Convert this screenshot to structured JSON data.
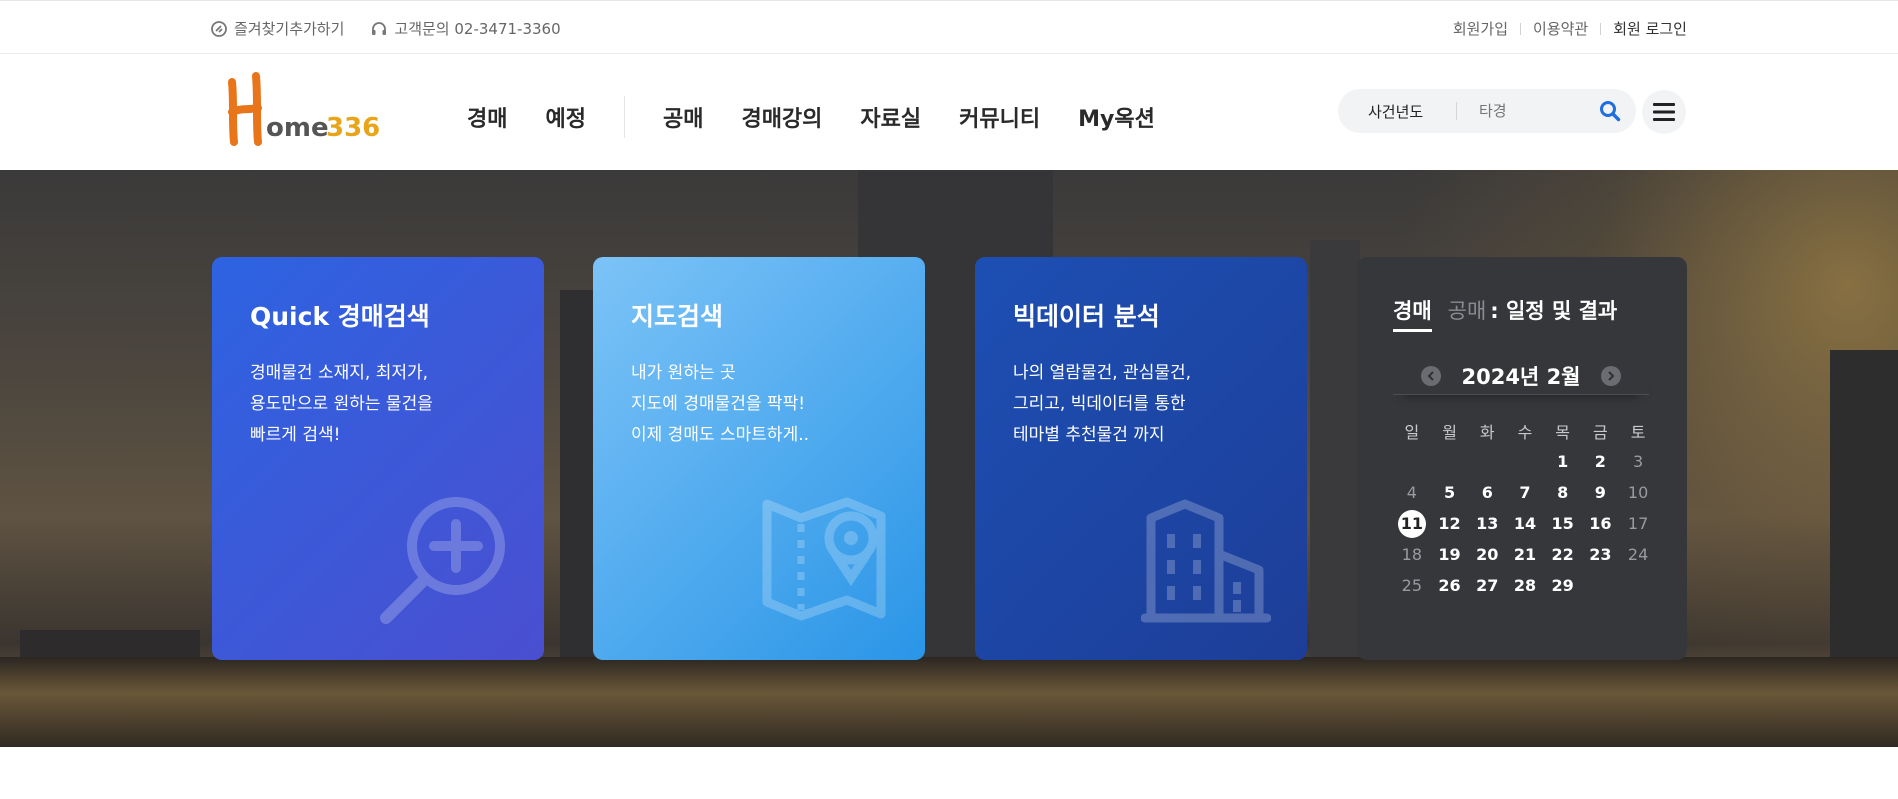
{
  "topbar": {
    "bookmark_label": "즐겨찾기추가하기",
    "contact_label": "고객문의 02-3471-3360",
    "links": [
      "회원가입",
      "이용약관",
      "회원 로그인"
    ]
  },
  "header": {
    "logo_text_h": "H",
    "logo_text_ome": "ome",
    "logo_text_num": "336",
    "nav_group1": [
      "경매",
      "예정"
    ],
    "nav_group2": [
      "공매",
      "경매강의",
      "자료실",
      "커뮤니티",
      "My옥션"
    ],
    "search": {
      "select_value": "사건년도",
      "placeholder": "타경"
    }
  },
  "cards": [
    {
      "title": "Quick 경매검색",
      "lines": [
        "경매물건 소재지, 최저가,",
        "용도만으로 원하는 물건을",
        "빠르게 검색!"
      ],
      "icon": "magnifier-plus-icon"
    },
    {
      "title": "지도검색",
      "lines": [
        "내가 원하는 곳",
        "지도에 경매물건을 팍팍!",
        "이제 경매도 스마트하게.."
      ],
      "icon": "map-pin-icon"
    },
    {
      "title": "빅데이터 분석",
      "lines": [
        "나의 열람물건, 관심물건,",
        "그리고, 빅데이터를 통한",
        "테마별 추천물건 까지"
      ],
      "icon": "building-icon"
    }
  ],
  "calendar": {
    "tab_active": "경매",
    "tab_inactive": "공매",
    "tab_suffix": ": 일정 및 결과",
    "month_title": "2024년 2월",
    "weekdays": [
      "일",
      "월",
      "화",
      "수",
      "목",
      "금",
      "토"
    ],
    "weeks": [
      [
        "",
        "",
        "",
        "",
        "1",
        "2",
        "3"
      ],
      [
        "4",
        "5",
        "6",
        "7",
        "8",
        "9",
        "10"
      ],
      [
        "11",
        "12",
        "13",
        "14",
        "15",
        "16",
        "17"
      ],
      [
        "18",
        "19",
        "20",
        "21",
        "22",
        "23",
        "24"
      ],
      [
        "25",
        "26",
        "27",
        "28",
        "29",
        "",
        ""
      ]
    ],
    "today": "11"
  },
  "colors": {
    "logo_orange": "#e8751a",
    "logo_green": "#4ea33c",
    "search_icon": "#1f6fe0"
  }
}
